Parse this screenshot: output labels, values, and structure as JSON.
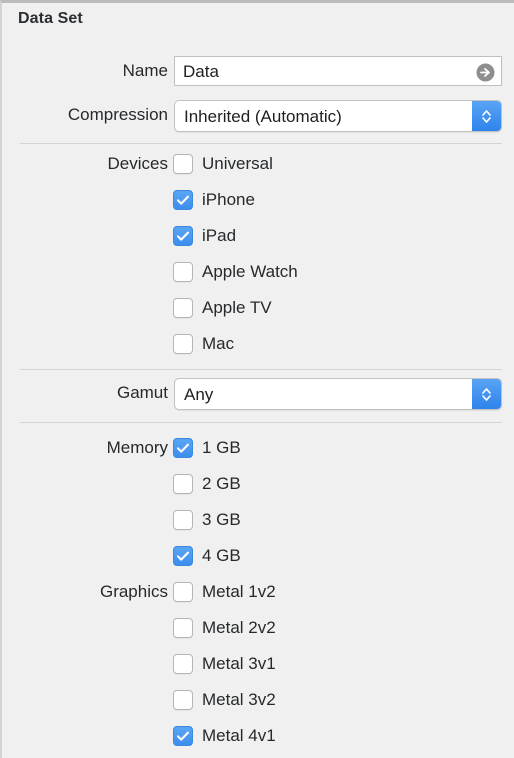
{
  "panel": {
    "title": "Data Set",
    "accent_color": "#3c8eee",
    "background_color": "#f0f0f0"
  },
  "fields": {
    "name": {
      "label": "Name",
      "value": "Data",
      "placeholder": "Name",
      "accessory_icon": "arrow-right-circle-icon"
    },
    "compression": {
      "label": "Compression",
      "value": "Inherited (Automatic)",
      "stepper_icon": "chevron-up-down-icon"
    },
    "gamut": {
      "label": "Gamut",
      "value": "Any",
      "stepper_icon": "chevron-up-down-icon"
    }
  },
  "groups": [
    {
      "label": "Devices",
      "options": [
        {
          "label": "Universal",
          "checked": false
        },
        {
          "label": "iPhone",
          "checked": true
        },
        {
          "label": "iPad",
          "checked": true
        },
        {
          "label": "Apple Watch",
          "checked": false
        },
        {
          "label": "Apple TV",
          "checked": false
        },
        {
          "label": "Mac",
          "checked": false
        }
      ]
    },
    {
      "label": "Memory",
      "options": [
        {
          "label": "1 GB",
          "checked": true
        },
        {
          "label": "2 GB",
          "checked": false
        },
        {
          "label": "3 GB",
          "checked": false
        },
        {
          "label": "4 GB",
          "checked": true
        }
      ]
    },
    {
      "label": "Graphics",
      "options": [
        {
          "label": "Metal 1v2",
          "checked": false
        },
        {
          "label": "Metal 2v2",
          "checked": false
        },
        {
          "label": "Metal 3v1",
          "checked": false
        },
        {
          "label": "Metal 3v2",
          "checked": false
        },
        {
          "label": "Metal 4v1",
          "checked": true
        }
      ]
    }
  ]
}
